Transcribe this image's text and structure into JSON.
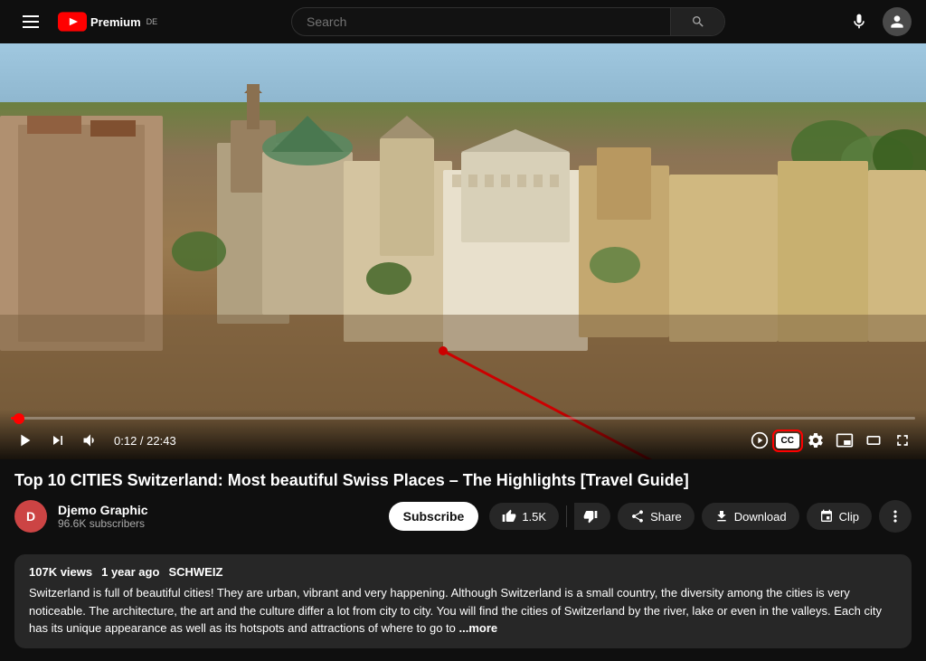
{
  "header": {
    "menu_label": "Menu",
    "logo_text": "Premium",
    "logo_de": "DE",
    "search_placeholder": "Search",
    "search_label": "Search"
  },
  "video": {
    "time_current": "0:12",
    "time_total": "22:43",
    "time_display": "0:12 / 22:43",
    "progress_percent": 0.9,
    "cc_label": "CC",
    "settings_label": "Settings",
    "miniplayer_label": "Miniplayer",
    "theater_label": "Theater mode",
    "fullscreen_label": "Fullscreen"
  },
  "video_info": {
    "title": "Top 10 CITIES Switzerland: Most beautiful Swiss Places – The Highlights [Travel Guide]",
    "channel_name": "Djemo Graphic",
    "subscriber_count": "96.6K subscribers",
    "subscribe_label": "Subscribe"
  },
  "actions": {
    "like_label": "1.5K",
    "dislike_label": "",
    "share_label": "Share",
    "download_label": "Download",
    "clip_label": "Clip",
    "more_label": "..."
  },
  "description": {
    "view_count": "107K views",
    "time_ago": "1 year ago",
    "tag": "SCHWEIZ",
    "text": "Switzerland is full of beautiful cities! They are urban, vibrant and very happening. Although Switzerland is a small country, the diversity among the cities is very noticeable. The architecture, the art and the culture differ a lot from city to city. You will find the cities of Switzerland by the river, lake or even in the valleys. Each city has its unique appearance as well as its hotspots and attractions of where to go to",
    "more_label": "...more"
  }
}
